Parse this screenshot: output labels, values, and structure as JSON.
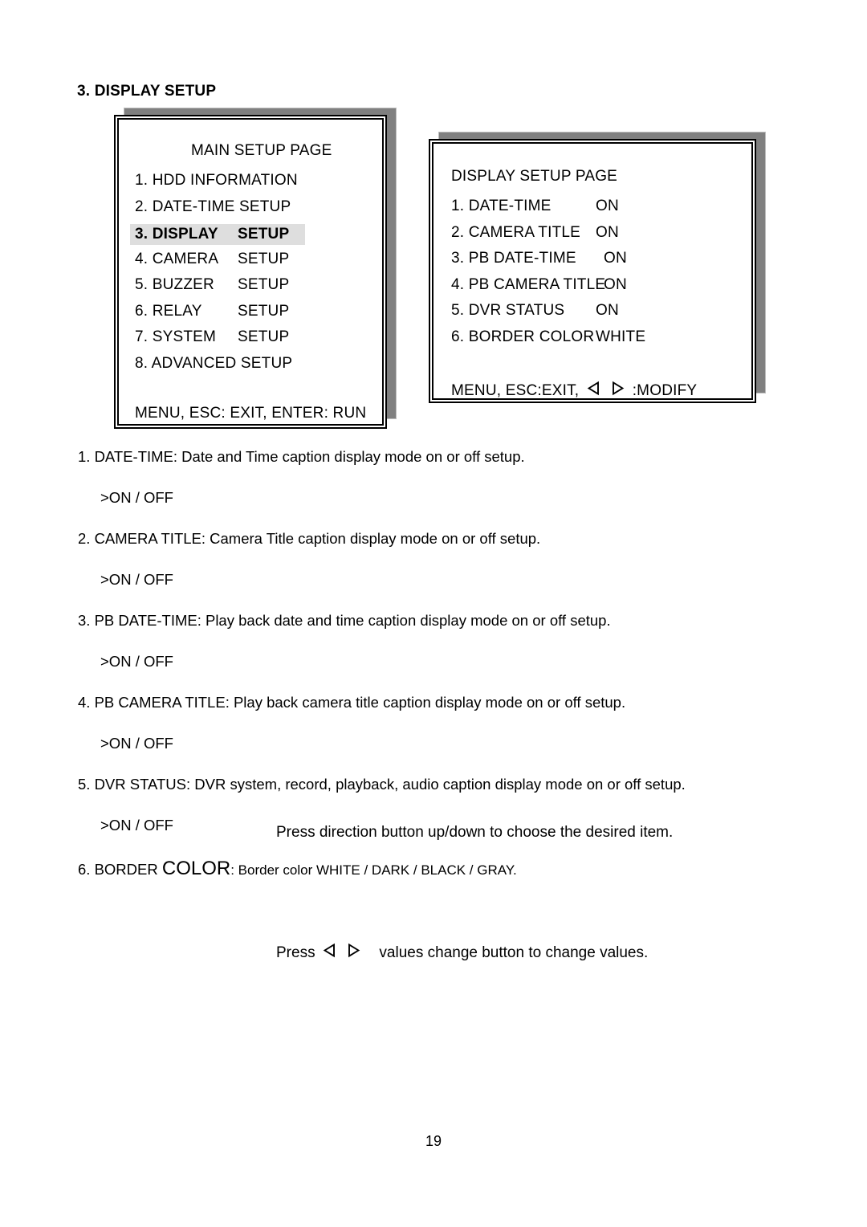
{
  "document": {
    "section_heading": "3. DISPLAY SETUP",
    "page_number": "19"
  },
  "main_setup_panel": {
    "title": "MAIN SETUP PAGE",
    "items": [
      {
        "label": "1. HDD INFORMATION",
        "suffix": "",
        "highlighted": false
      },
      {
        "label": "2. DATE-TIME SETUP",
        "suffix": "",
        "highlighted": false
      },
      {
        "label": "3. DISPLAY",
        "suffix": "SETUP",
        "highlighted": true
      },
      {
        "label": "4. CAMERA",
        "suffix": "SETUP",
        "highlighted": false
      },
      {
        "label": "5. BUZZER",
        "suffix": "SETUP",
        "highlighted": false
      },
      {
        "label": "6. RELAY",
        "suffix": "SETUP",
        "highlighted": false
      },
      {
        "label": "7. SYSTEM",
        "suffix": "SETUP",
        "highlighted": false
      },
      {
        "label": "8. ADVANCED SETUP",
        "suffix": "",
        "highlighted": false
      }
    ],
    "footer": "MENU, ESC: EXIT, ENTER: RUN"
  },
  "display_setup_panel": {
    "title": "DISPLAY SETUP PAGE",
    "items": [
      {
        "label": "1. DATE-TIME",
        "value": "ON"
      },
      {
        "label": "2. CAMERA TITLE",
        "value": "ON"
      },
      {
        "label": "3. PB DATE-TIME",
        "value": "ON"
      },
      {
        "label": "4. PB CAMERA TITLE",
        "value": "ON"
      },
      {
        "label": "5. DVR STATUS",
        "value": "ON"
      },
      {
        "label": "6. BORDER COLOR",
        "value": "WHITE"
      }
    ],
    "footer_prefix": "MENU, ESC:EXIT,",
    "footer_suffix": ":MODIFY"
  },
  "descriptions": [
    {
      "line": "1. DATE-TIME: Date and Time caption display mode on or off setup.",
      "options": ">ON / OFF"
    },
    {
      "line": "2. CAMERA TITLE: Camera Title caption display mode on or off setup.",
      "options": ">ON / OFF"
    },
    {
      "line": "3. PB DATE-TIME: Play back date and time caption display mode on or off setup.",
      "options": ">ON / OFF"
    },
    {
      "line": "4. PB CAMERA TITLE: Play back camera title caption display mode on or off setup.",
      "options": ">ON / OFF"
    },
    {
      "line": "5. DVR STATUS: DVR system, record, playback, audio caption display mode on or off setup.",
      "options": ">ON / OFF"
    }
  ],
  "border_color_item": {
    "prefix": "6. BORDER ",
    "emphasis": "COLOR",
    "suffix": ": Border color WHITE / DARK / BLACK / GRAY."
  },
  "notes": {
    "note_direction": "Press direction button up/down to choose the desired item.",
    "note_values_prefix": "Press",
    "note_values_suffix": "values change button to change values."
  },
  "colors": {
    "highlight_background": "#dedede",
    "panel_shadow": "#808080",
    "text": "#000000",
    "page_background": "#ffffff"
  },
  "icons": {
    "arrow_left": "triangle-left-outline",
    "arrow_right": "triangle-right-outline"
  }
}
